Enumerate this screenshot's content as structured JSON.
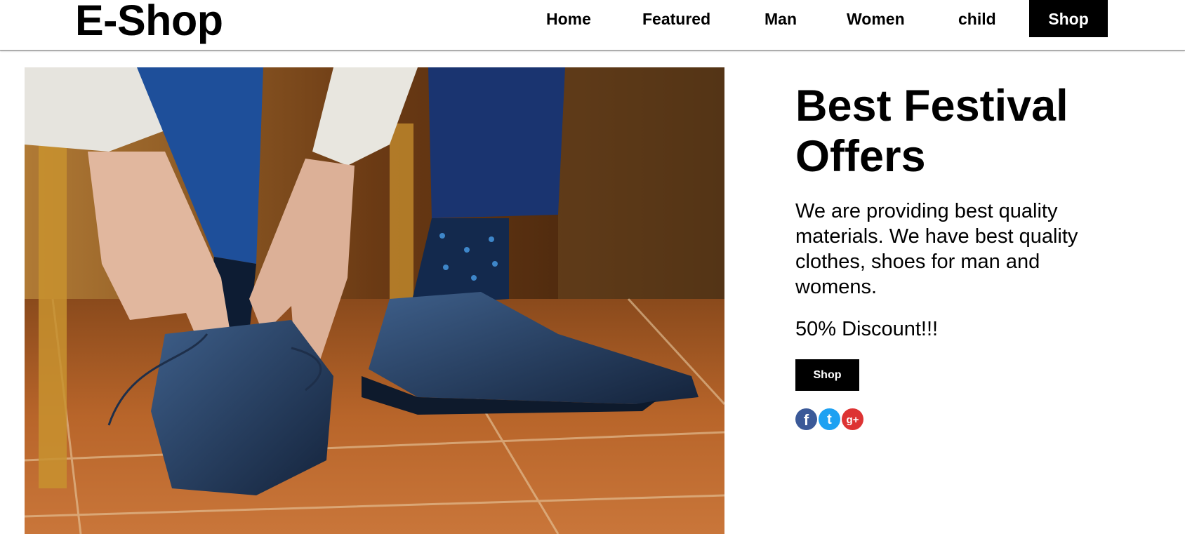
{
  "header": {
    "logo": "E-Shop",
    "nav": [
      {
        "label": "Home"
      },
      {
        "label": "Featured"
      },
      {
        "label": "Man"
      },
      {
        "label": "Women"
      },
      {
        "label": "child"
      },
      {
        "label": "Shop",
        "active": true
      }
    ]
  },
  "hero": {
    "image_description_icon": "shoe-lacing-photo"
  },
  "promo": {
    "title_line1": "Best Festival",
    "title_line2": "Offers",
    "description": "We are providing best quality materials. We have best quality clothes, shoes for man and womens.",
    "discount": "50% Discount!!!",
    "button_label": "Shop"
  },
  "social": [
    {
      "icon": "facebook-icon",
      "glyph": "f",
      "color": "#3b5998"
    },
    {
      "icon": "twitter-icon",
      "glyph": "t",
      "color": "#1da1f2"
    },
    {
      "icon": "google-plus-icon",
      "glyph": "g+",
      "color": "#dd3333"
    }
  ]
}
